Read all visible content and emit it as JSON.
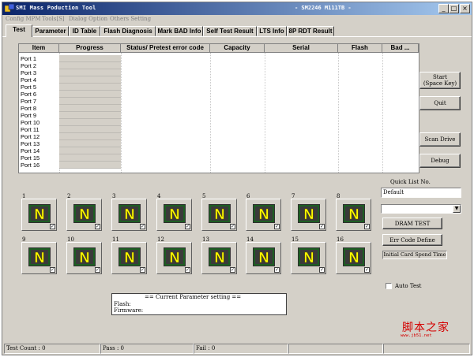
{
  "window": {
    "title": "SMI Mass Poduction Tool",
    "subtitle": "- SM2246 M111TB -",
    "minimize": "_",
    "maximize": "□",
    "close": "×"
  },
  "menu": [
    "Config MPM",
    "Tools[S]",
    "Dialog Option",
    "Others Setting"
  ],
  "tabs": [
    "Test",
    "Parameter",
    "ID Table",
    "Flash Diagnosis",
    "Mark BAD Info",
    "Self Test Result",
    "LTS Info",
    "8P RDT Result"
  ],
  "grid": {
    "columns": [
      "Item",
      "Progress",
      "Status/ Pretest error code",
      "Capacity",
      "Serial",
      "Flash",
      "Bad ..."
    ],
    "ports": [
      "Port 1",
      "Port 2",
      "Port 3",
      "Port 4",
      "Port 5",
      "Port 6",
      "Port 7",
      "Port 8",
      "Port 9",
      "Port 10",
      "Port 11",
      "Port 12",
      "Port 13",
      "Port 14",
      "Port 15",
      "Port 16"
    ]
  },
  "buttons": {
    "start": "Start\n(Space Key)",
    "quit": "Quit",
    "scan": "Scan Drive",
    "debug": "Debug",
    "dram_test": "DRAM TEST",
    "err_code": "Err Code Define"
  },
  "slots": {
    "labels": [
      "1",
      "2",
      "3",
      "4",
      "5",
      "6",
      "7",
      "8",
      "9",
      "10",
      "11",
      "12",
      "13",
      "14",
      "15",
      "16"
    ],
    "icon_letter": "N",
    "icon_name": "device-not-ready-icon"
  },
  "quick_list": {
    "label": "Quick List No.",
    "value": "Default",
    "select_value": ""
  },
  "init_card_label": "Initial Card Spend Time",
  "auto_test": {
    "label": "Auto Test",
    "checked": false
  },
  "param_setting": {
    "title": "== Current Parameter setting ==",
    "flash_label": "Flash:",
    "firmware_label": "Firmware:"
  },
  "watermark": {
    "text": "脚本之家",
    "sub": "www.jb51.net"
  },
  "status": {
    "test_count": "Test Count : 0",
    "pass": "Pass : 0",
    "fail": "Fail : 0"
  },
  "colors": {
    "titlebar_start": "#0a246a",
    "titlebar_end": "#a6caf0",
    "face": "#d4d0c8",
    "icon_yellow": "#ffff00",
    "icon_green": "#2e7d32",
    "watermark": "#d40000"
  }
}
